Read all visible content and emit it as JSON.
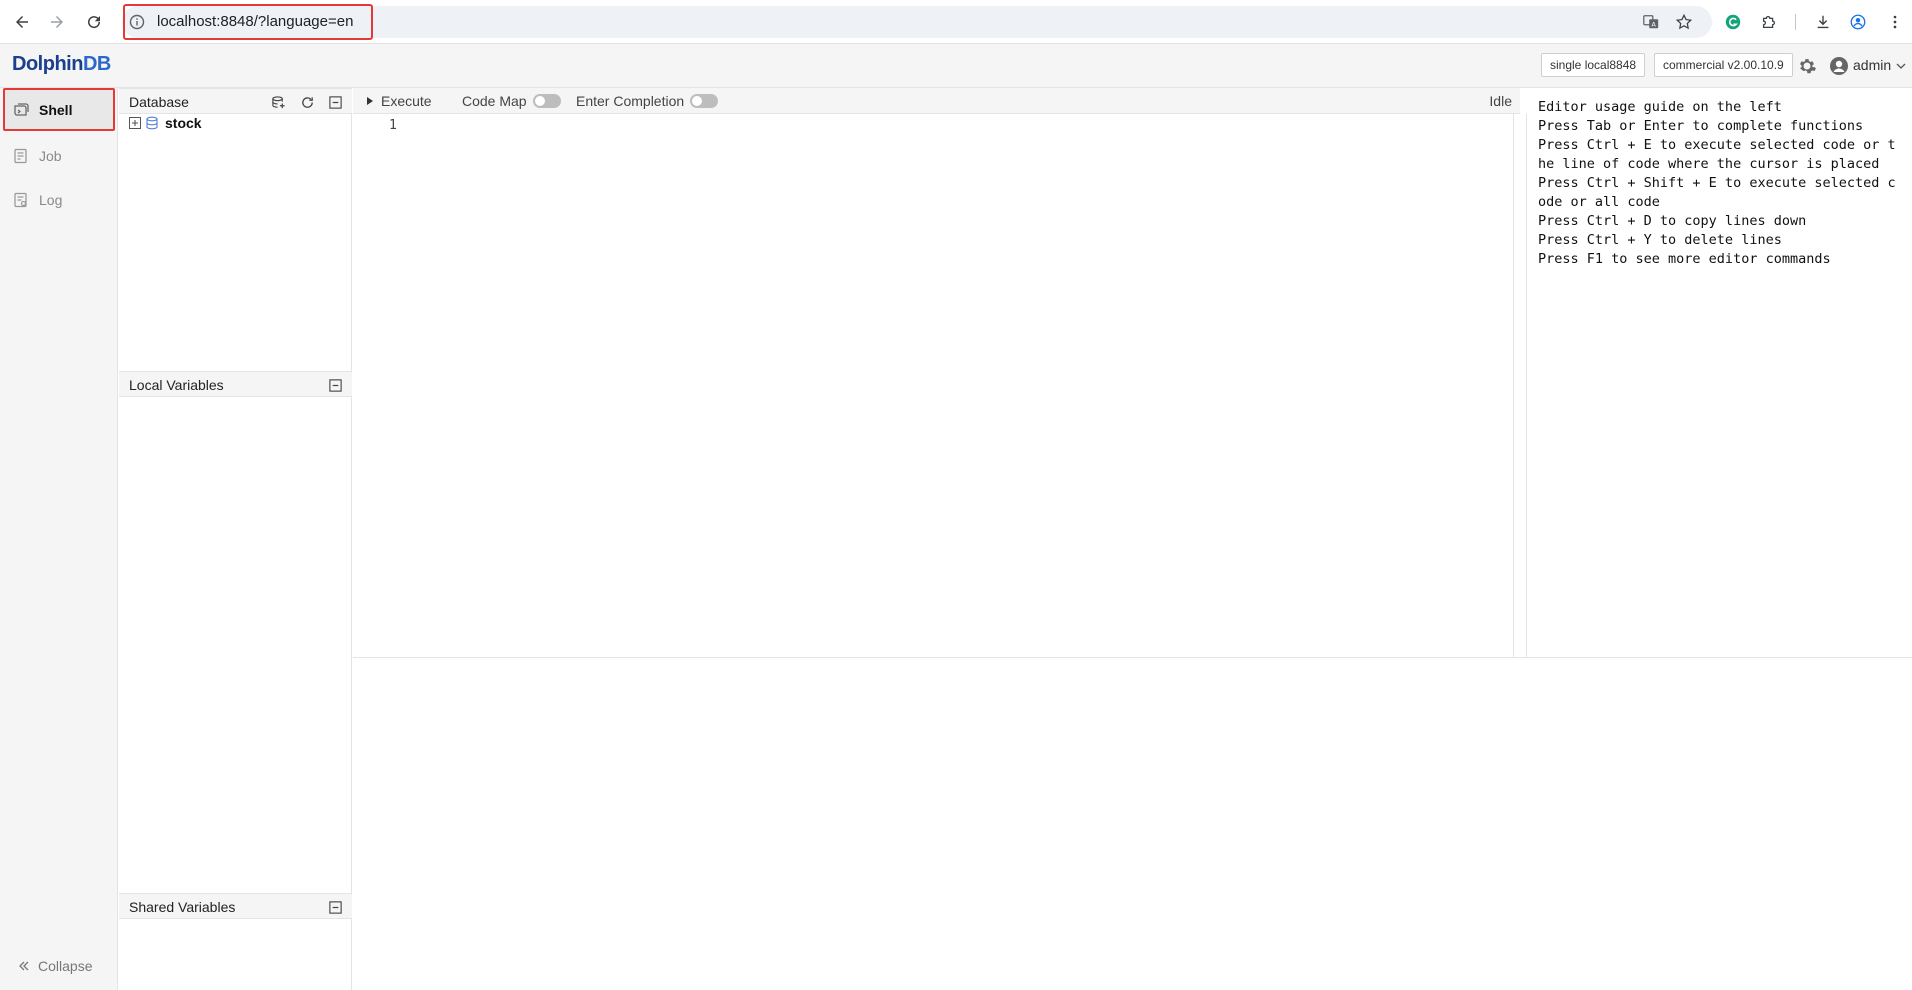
{
  "browser": {
    "url": "localhost:8848/?language=en"
  },
  "header": {
    "logo_text": "DolphinDB",
    "logo_first": "D",
    "logo_mid": "olphin",
    "logo_last": "DB",
    "node_tag": "single local8848",
    "version_tag": "commercial v2.00.10.9",
    "user": "admin"
  },
  "sidebar": {
    "items": [
      {
        "label": "Shell",
        "icon": "shell-icon",
        "active": true
      },
      {
        "label": "Job",
        "icon": "job-icon",
        "active": false
      },
      {
        "label": "Log",
        "icon": "log-icon",
        "active": false
      }
    ],
    "collapse_label": "Collapse"
  },
  "panels": {
    "database_title": "Database",
    "database_tree": [
      {
        "name": "stock"
      }
    ],
    "local_vars_title": "Local Variables",
    "shared_vars_title": "Shared Variables"
  },
  "toolbar": {
    "execute_label": "Execute",
    "code_map_label": "Code Map",
    "enter_completion_label": "Enter Completion",
    "status": "Idle"
  },
  "editor": {
    "line_numbers": [
      "1"
    ]
  },
  "guide": {
    "lines": [
      "Editor usage guide on the left",
      "Press Tab or Enter to complete functions",
      "Press Ctrl + E to execute selected code or t",
      "he line of code where the cursor is placed",
      "Press Ctrl + Shift + E to execute selected c",
      "ode or all code",
      "Press Ctrl + D to copy lines down",
      "Press Ctrl + Y to delete lines",
      "Press F1 to see more editor commands"
    ]
  },
  "colors": {
    "highlight_red": "#e53935",
    "logo_blue": "#1b3f8f",
    "sidebar_bg": "#f5f5f5"
  }
}
